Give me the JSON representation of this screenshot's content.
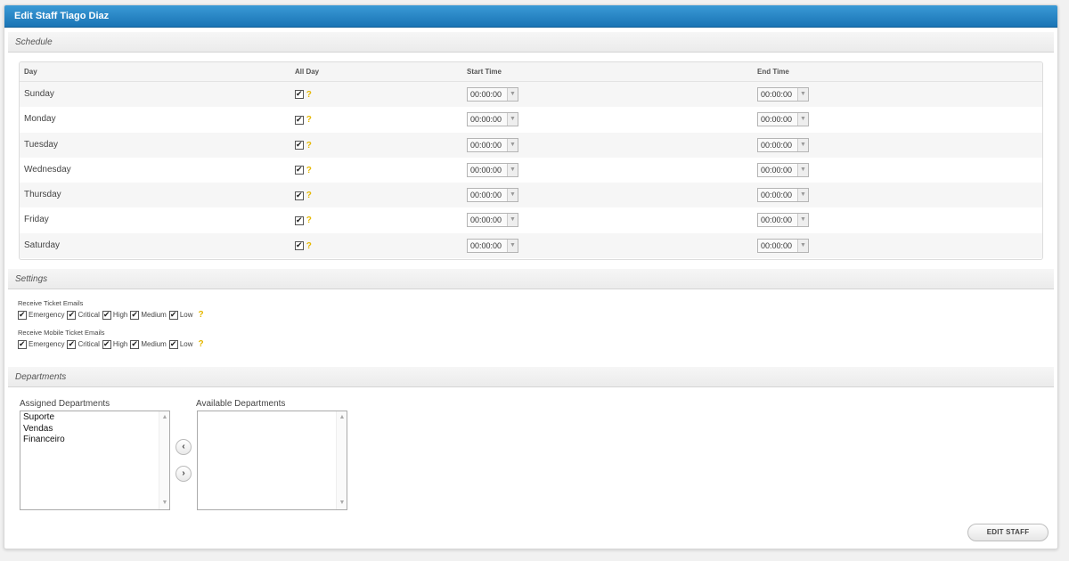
{
  "title": "Edit Staff Tiago Diaz",
  "schedule": {
    "section_label": "Schedule",
    "headers": {
      "day": "Day",
      "all_day": "All Day",
      "start": "Start Time",
      "end": "End Time"
    },
    "help_glyph": "?",
    "rows": [
      {
        "day": "Sunday",
        "all_day": true,
        "start": "00:00:00",
        "end": "00:00:00"
      },
      {
        "day": "Monday",
        "all_day": true,
        "start": "00:00:00",
        "end": "00:00:00"
      },
      {
        "day": "Tuesday",
        "all_day": true,
        "start": "00:00:00",
        "end": "00:00:00"
      },
      {
        "day": "Wednesday",
        "all_day": true,
        "start": "00:00:00",
        "end": "00:00:00"
      },
      {
        "day": "Thursday",
        "all_day": true,
        "start": "00:00:00",
        "end": "00:00:00"
      },
      {
        "day": "Friday",
        "all_day": true,
        "start": "00:00:00",
        "end": "00:00:00"
      },
      {
        "day": "Saturday",
        "all_day": true,
        "start": "00:00:00",
        "end": "00:00:00"
      }
    ]
  },
  "settings": {
    "section_label": "Settings",
    "ticket_emails": {
      "label": "Receive Ticket Emails",
      "options": [
        {
          "label": "Emergency",
          "checked": true
        },
        {
          "label": "Critical",
          "checked": true
        },
        {
          "label": "High",
          "checked": true
        },
        {
          "label": "Medium",
          "checked": true
        },
        {
          "label": "Low",
          "checked": true
        }
      ]
    },
    "mobile_ticket_emails": {
      "label": "Receive Mobile Ticket Emails",
      "options": [
        {
          "label": "Emergency",
          "checked": true
        },
        {
          "label": "Critical",
          "checked": true
        },
        {
          "label": "High",
          "checked": true
        },
        {
          "label": "Medium",
          "checked": true
        },
        {
          "label": "Low",
          "checked": true
        }
      ]
    }
  },
  "departments": {
    "section_label": "Departments",
    "assigned_label": "Assigned Departments",
    "available_label": "Available Departments",
    "assigned": [
      "Suporte",
      "Vendas",
      "Financeiro"
    ],
    "available": [],
    "move_left_glyph": "‹",
    "move_right_glyph": "›"
  },
  "edit_button": "EDIT STAFF",
  "colors": {
    "header_bar": "#1a74b5",
    "help": "#e6b800"
  }
}
